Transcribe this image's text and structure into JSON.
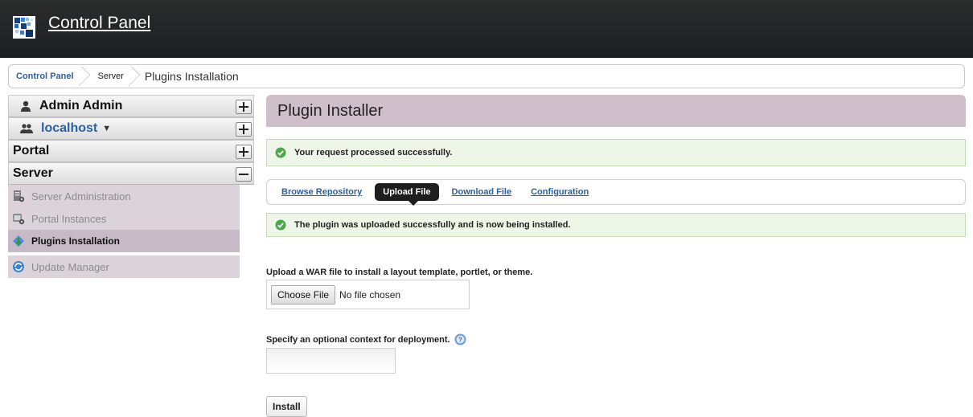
{
  "header": {
    "title": "Control Panel",
    "logo_icon": "liferay-logo-icon"
  },
  "breadcrumb": {
    "items": [
      "Control Panel",
      "Server"
    ],
    "current": "Plugins Installation"
  },
  "sidebar": {
    "user": "Admin Admin",
    "site": "localhost",
    "site_caret": "▼",
    "portal": "Portal",
    "server": "Server",
    "items": [
      {
        "label": "Server Administration",
        "icon": "server-admin-icon"
      },
      {
        "label": "Portal Instances",
        "icon": "portal-instances-icon"
      },
      {
        "label": "Plugins Installation",
        "icon": "plugins-installation-icon"
      },
      {
        "label": "Update Manager",
        "icon": "update-manager-icon"
      }
    ]
  },
  "main": {
    "title": "Plugin Installer",
    "message_top": "Your request processed successfully.",
    "tabs": [
      {
        "label": "Browse Repository"
      },
      {
        "label": "Upload File"
      },
      {
        "label": "Download File"
      },
      {
        "label": "Configuration"
      }
    ],
    "active_tab": "Upload File",
    "message_upload": "The plugin was uploaded successfully and is now being installed.",
    "upload_label": "Upload a WAR file to install a layout template, portlet, or theme.",
    "choose_file": "Choose File",
    "no_file": "No file chosen",
    "context_label": "Specify an optional context for deployment.",
    "context_value": "",
    "install": "Install"
  },
  "colors": {
    "topbar": "#1b1f22",
    "accent": "#2c5fa0",
    "title_bg": "#cfbfcb",
    "success_bg": "#eef7e7"
  }
}
